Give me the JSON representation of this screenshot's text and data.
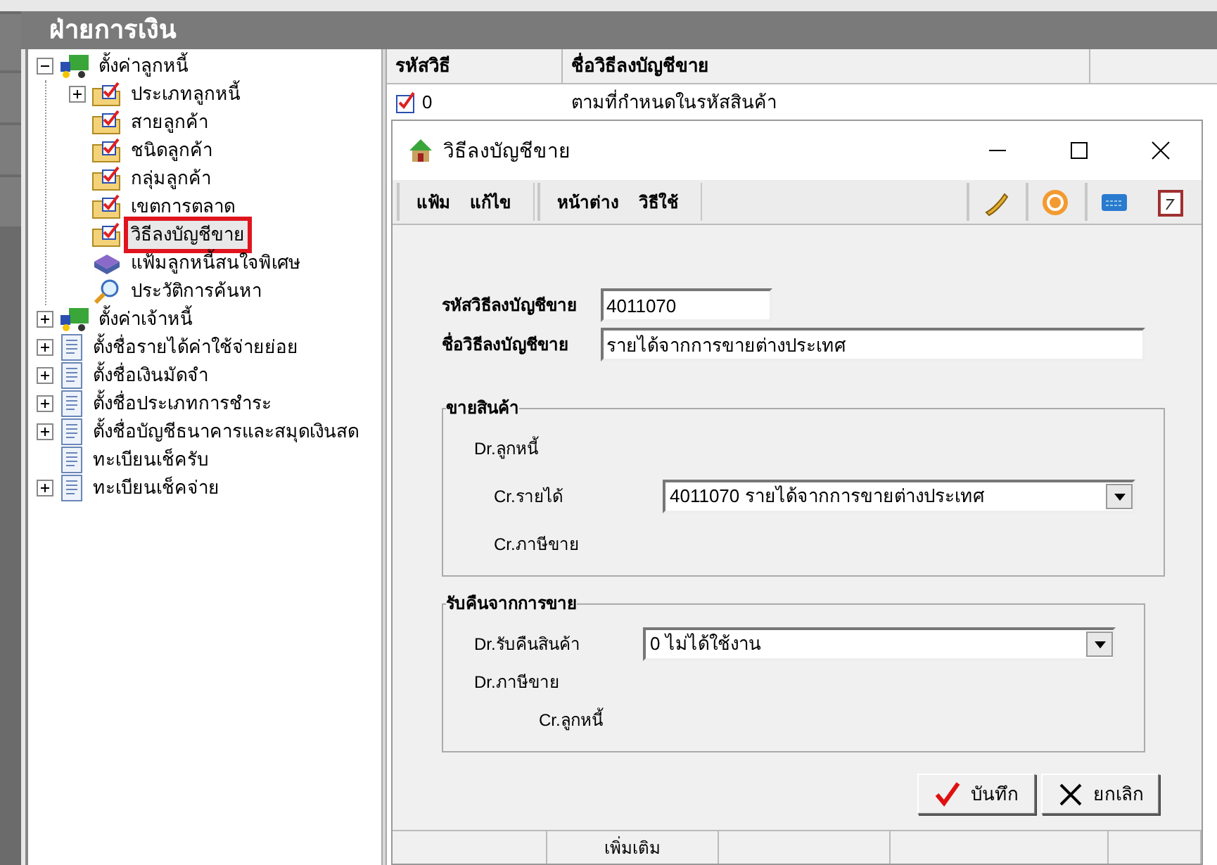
{
  "header": {
    "title": "ฝ่ายการเงิน"
  },
  "tree": [
    {
      "label": "ตั้งค่าลูกหนี้",
      "kind": "truck",
      "expanded": true,
      "selected": false,
      "children": [
        {
          "label": "ประเภทลูกหนี้",
          "kind": "folder",
          "expanded": false,
          "selected": false
        },
        {
          "label": "สายลูกค้า",
          "kind": "folder",
          "selected": false
        },
        {
          "label": "ชนิดลูกค้า",
          "kind": "folder",
          "selected": false
        },
        {
          "label": "กลุ่มลูกค้า",
          "kind": "folder",
          "selected": false
        },
        {
          "label": "เขตการตลาด",
          "kind": "folder",
          "selected": false
        },
        {
          "label": "วิธีลงบัญชีขาย",
          "kind": "folder",
          "selected": true
        },
        {
          "label": "แฟ้มลูกหนี้สนใจพิเศษ",
          "kind": "book",
          "selected": false
        },
        {
          "label": "ประวัติการค้นหา",
          "kind": "search",
          "selected": false
        }
      ]
    },
    {
      "label": "ตั้งค่าเจ้าหนี้",
      "kind": "truck",
      "expanded": false,
      "selected": false
    },
    {
      "label": "ตั้งชื่อรายได้ค่าใช้จ่ายย่อย",
      "kind": "doc",
      "expanded": false,
      "selected": false
    },
    {
      "label": "ตั้งชื่อเงินมัดจำ",
      "kind": "doc",
      "expanded": false,
      "selected": false
    },
    {
      "label": "ตั้งชื่อประเภทการชำระ",
      "kind": "doc",
      "expanded": false,
      "selected": false
    },
    {
      "label": "ตั้งชื่อบัญชีธนาคารและสมุดเงินสด",
      "kind": "doc",
      "expanded": false,
      "selected": false
    },
    {
      "label": "ทะเบียนเช็ครับ",
      "kind": "doc",
      "selected": false
    },
    {
      "label": "ทะเบียนเช็คจ่าย",
      "kind": "doc",
      "expanded": false,
      "selected": false
    }
  ],
  "table": {
    "columns": [
      "รหัสวิธี",
      "ชื่อวิธีลงบัญชีขาย"
    ],
    "rows": [
      [
        "0",
        "ตามที่กำหนดในรหัสสินค้า"
      ]
    ]
  },
  "dialog": {
    "title": "วิธีลงบัญชีขาย",
    "menu_groups": [
      [
        "แฟ้ม",
        "แก้ไข"
      ],
      [
        "หน้าต่าง",
        "วิธีใช้"
      ]
    ],
    "fields": [
      {
        "label": "รหัสวิธีลงบัญชีขาย",
        "value": "4011070"
      },
      {
        "label": "ชื่อวิธีลงบัญชีขาย",
        "value": "รายได้จากการขายต่างประเทศ"
      }
    ],
    "groups": [
      {
        "title": "ขายสินค้า",
        "lines": [
          {
            "label": "Dr.ลูกหนี้",
            "kind": "dr"
          },
          {
            "label": "Cr.รายได้",
            "kind": "cr",
            "select": "4011070 รายได้จากการขายต่างประเทศ"
          },
          {
            "label": "Cr.ภาษีขาย",
            "kind": "cr"
          }
        ]
      },
      {
        "title": "รับคืนจากการขาย",
        "lines": [
          {
            "label": "Dr.รับคืนสินค้า",
            "kind": "dr",
            "select": "0 ไม่ได้ใช้งาน"
          },
          {
            "label": "Dr.ภาษีขาย",
            "kind": "dr"
          },
          {
            "label": "Cr.ลูกหนี้",
            "kind": "cr2"
          }
        ]
      }
    ],
    "buttons": [
      {
        "label": "บันทึก",
        "kind": "save"
      },
      {
        "label": "ยกเลิก",
        "kind": "cancel"
      }
    ],
    "status_bar": [
      "เพิ่มเติม"
    ]
  }
}
